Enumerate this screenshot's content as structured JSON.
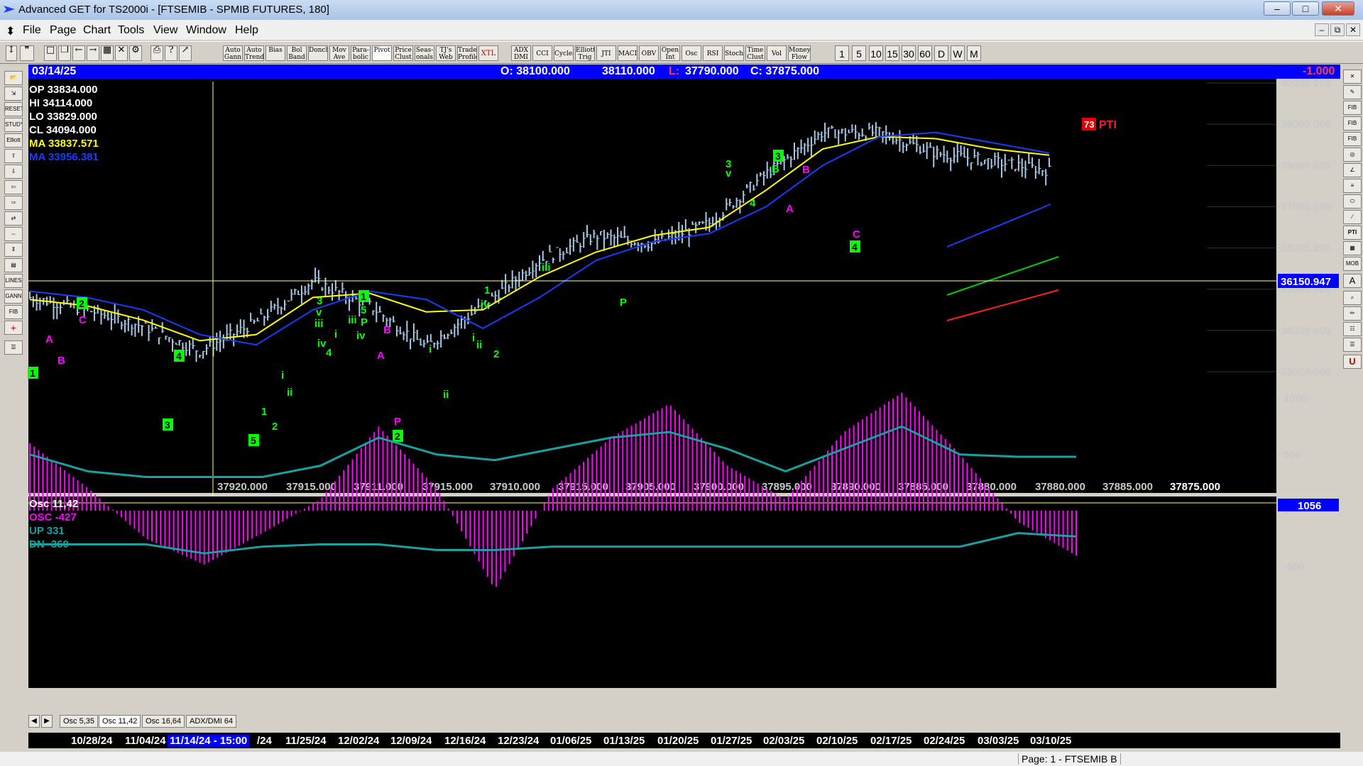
{
  "window": {
    "title": "Advanced GET for TS2000i - [FTSEMIB - SPMIB FUTURES, 180]",
    "minimize": "–",
    "maximize": "□",
    "close": "✕"
  },
  "menu": {
    "items": [
      "File",
      "Page",
      "Chart",
      "Tools",
      "View",
      "Window",
      "Help"
    ],
    "mdi": [
      "–",
      "⧉",
      "✕"
    ]
  },
  "toolbar": {
    "studies": [
      "Auto Gann",
      "Auto Trend",
      "Bias",
      "Bol Band",
      "Donch",
      "Mov Ave",
      "Para-bolic",
      "Pivot",
      "Price Clust",
      "Seas-onals",
      "TJ's Web",
      "Trade Profile",
      "XTL",
      "ADX DMI",
      "CCI",
      "Cycles",
      "Elliott Trig",
      "JTI",
      "MACD",
      "OBV",
      "Open Int",
      "Osc",
      "RSI",
      "Stoch",
      "Time Clust",
      "Vol",
      "Money Flow"
    ],
    "intervals": [
      "1",
      "5",
      "10",
      "15",
      "30",
      "60",
      "D",
      "W",
      "M"
    ]
  },
  "infobar": {
    "date": "03/14/25",
    "open": "O: 38100.000",
    "high": "38110.000",
    "low_label": "L:",
    "low": "37790.000",
    "close": "C: 37875.000",
    "change": "-1.000"
  },
  "price_panel": {
    "ohlc_box": {
      "op": "OP  33834.000",
      "hi": "HI   34114.000",
      "lo": "LO  33829.000",
      "cl": "CL  34094.000",
      "ma1": "MA  33837.571",
      "ma2": "MA  33956.381"
    },
    "axis_ticks": [
      "40000.000",
      "39000.000",
      "38000.000",
      "37000.000",
      "36000.000",
      "35000.000",
      "34000.000",
      "33000.000"
    ],
    "cursor_price": "36150.947",
    "pti_value": "73",
    "pti_label": "PTI",
    "bottom_values": [
      "37920.000",
      "37915.000",
      "37911.000",
      "37915.000",
      "37910.000",
      "37915.000",
      "37905.000",
      "37900.000",
      "37895.000",
      "37890.000",
      "37885.000",
      "37880.000",
      "37880.000",
      "37885.000",
      "37875.000"
    ],
    "wave_labels": [
      {
        "t": "1",
        "boxed": true,
        "color": "#00ff00"
      },
      {
        "t": "A",
        "boxed": false,
        "color": "#ff00ff"
      },
      {
        "t": "B",
        "boxed": false,
        "color": "#ff00ff"
      },
      {
        "t": "2",
        "boxed": true,
        "color": "#00ff00"
      },
      {
        "t": "C",
        "boxed": false,
        "color": "#ff00ff"
      },
      {
        "t": "3",
        "boxed": true,
        "color": "#00ff00"
      },
      {
        "t": "4",
        "boxed": true,
        "color": "#00ff00"
      },
      {
        "t": "5",
        "boxed": true,
        "color": "#00ff00"
      },
      {
        "t": "1",
        "boxed": false,
        "color": "#00ff00"
      },
      {
        "t": "2",
        "boxed": false,
        "color": "#00ff00"
      },
      {
        "t": "i",
        "boxed": false,
        "color": "#00ff00"
      },
      {
        "t": "ii",
        "boxed": false,
        "color": "#00ff00"
      },
      {
        "t": "3",
        "boxed": false,
        "color": "#00ff00"
      },
      {
        "t": "v",
        "boxed": false,
        "color": "#00ff00"
      },
      {
        "t": "iii",
        "boxed": false,
        "color": "#00ff00"
      },
      {
        "t": "iv",
        "boxed": false,
        "color": "#00ff00"
      },
      {
        "t": "i",
        "boxed": false,
        "color": "#00ff00"
      },
      {
        "t": "4",
        "boxed": false,
        "color": "#00ff00"
      },
      {
        "t": "iii",
        "boxed": false,
        "color": "#00ff00"
      },
      {
        "t": "1",
        "boxed": true,
        "color": "#00ff00"
      },
      {
        "t": "5",
        "boxed": false,
        "color": "#00ff00"
      },
      {
        "t": "P",
        "boxed": false,
        "color": "#00ff00"
      },
      {
        "t": "iv",
        "boxed": false,
        "color": "#00ff00"
      },
      {
        "t": "B",
        "boxed": false,
        "color": "#ff00ff"
      },
      {
        "t": "A",
        "boxed": false,
        "color": "#ff00ff"
      },
      {
        "t": "P",
        "boxed": false,
        "color": "#ff00ff"
      },
      {
        "t": "2",
        "boxed": true,
        "color": "#00ff00"
      },
      {
        "t": "i",
        "boxed": false,
        "color": "#00ff00"
      },
      {
        "t": "ii",
        "boxed": false,
        "color": "#00ff00"
      },
      {
        "t": "1",
        "boxed": false,
        "color": "#00ff00"
      },
      {
        "t": "iv",
        "boxed": false,
        "color": "#00ff00"
      },
      {
        "t": "i",
        "boxed": false,
        "color": "#00ff00"
      },
      {
        "t": "ii",
        "boxed": false,
        "color": "#00ff00"
      },
      {
        "t": "2",
        "boxed": false,
        "color": "#00ff00"
      },
      {
        "t": "iii",
        "boxed": false,
        "color": "#00ff00"
      },
      {
        "t": "P",
        "boxed": false,
        "color": "#00ff00"
      },
      {
        "t": "3",
        "boxed": false,
        "color": "#00ff00"
      },
      {
        "t": "v",
        "boxed": false,
        "color": "#00ff00"
      },
      {
        "t": "4",
        "boxed": false,
        "color": "#00ff00"
      },
      {
        "t": "3",
        "boxed": true,
        "color": "#00ff00"
      },
      {
        "t": "B",
        "boxed": false,
        "color": "#00ff00"
      },
      {
        "t": "B",
        "boxed": false,
        "color": "#ff00ff"
      },
      {
        "t": "A",
        "boxed": false,
        "color": "#ff00ff"
      },
      {
        "t": "C",
        "boxed": false,
        "color": "#ff00ff"
      },
      {
        "t": "4",
        "boxed": true,
        "color": "#00ff00"
      }
    ]
  },
  "osc_panel": {
    "title": "Osc 11,42",
    "osc": "OSC -427",
    "up": "UP   331",
    "dn": "DN   -360",
    "current_value": "1056",
    "axis_ticks": [
      "1000",
      "500",
      "0",
      "-500"
    ]
  },
  "tabs": [
    "Osc 5,35",
    "Osc 11,42",
    "Osc 16,64",
    "ADX/DMI 64"
  ],
  "dates": [
    "10/28/24",
    "11/04/24",
    "11/14/24 - 15:00",
    "/24",
    "11/25/24",
    "12/02/24",
    "12/09/24",
    "12/16/24",
    "12/23/24",
    "01/06/25",
    "01/13/25",
    "01/20/25",
    "01/27/25",
    "02/03/25",
    "02/10/25",
    "02/17/25",
    "02/24/25",
    "03/03/25",
    "03/10/25"
  ],
  "status": {
    "page": "Page: 1 - FTSEMIB B"
  },
  "colors": {
    "bars": "#a8c8e8",
    "ma_yellow": "#ffff00",
    "ma_blue": "#1a3cff",
    "osc_magenta": "#ff00ff",
    "band_teal": "#1aa0a0",
    "cursor_line": "#ffff80",
    "wave_green": "#00ff00",
    "wave_magenta": "#ff00ff",
    "chart_bg": "#000000",
    "panel_gray": "#d4d0c8"
  },
  "chart_data": [
    {
      "type": "candlestick",
      "title": "FTSEMIB - SPMIB FUTURES, 180",
      "ylim": [
        32200,
        40000
      ],
      "x": [
        "10/28/24",
        "11/04/24",
        "11/14/24",
        "11/25/24",
        "12/02/24",
        "12/09/24",
        "12/16/24",
        "12/23/24",
        "01/06/25",
        "01/13/25",
        "01/20/25",
        "01/27/25",
        "02/03/25",
        "02/10/25",
        "02/17/25",
        "02/24/25",
        "03/03/25",
        "03/10/25",
        "03/14/25"
      ],
      "close": [
        34800,
        34500,
        34100,
        33500,
        34200,
        35200,
        34600,
        33600,
        34600,
        35700,
        36300,
        36100,
        36600,
        37800,
        38800,
        38800,
        38300,
        38100,
        37875
      ],
      "moving_averages": [
        {
          "name": "MA",
          "color": "#ffff00",
          "values": [
            34750,
            34600,
            34250,
            33750,
            33900,
            34800,
            34900,
            34450,
            34500,
            35300,
            35900,
            36300,
            36500,
            37400,
            38400,
            38700,
            38650,
            38400,
            38250
          ]
        },
        {
          "name": "MA",
          "color": "#1a3cff",
          "values": [
            34950,
            34800,
            34500,
            33900,
            33650,
            34500,
            34950,
            34750,
            34050,
            34800,
            35700,
            36150,
            36350,
            37000,
            38000,
            38700,
            38800,
            38550,
            38300
          ]
        }
      ],
      "cursor_price": 36150.947
    },
    {
      "type": "bar",
      "title": "Osc 11,42",
      "ylim": [
        -800,
        1050
      ],
      "values": [
        600,
        200,
        -250,
        -480,
        -200,
        100,
        750,
        200,
        -700,
        200,
        650,
        950,
        400,
        100,
        700,
        1050,
        500,
        -100,
        -400
      ],
      "bands": {
        "up": [
          500,
          350,
          300,
          300,
          300,
          400,
          650,
          500,
          450,
          550,
          650,
          700,
          550,
          350,
          550,
          750,
          500,
          480,
          480
        ],
        "dn": [
          -300,
          -300,
          -300,
          -380,
          -320,
          -300,
          -300,
          -350,
          -350,
          -320,
          -320,
          -320,
          -320,
          -320,
          -320,
          -320,
          -320,
          -200,
          -230
        ]
      }
    }
  ]
}
